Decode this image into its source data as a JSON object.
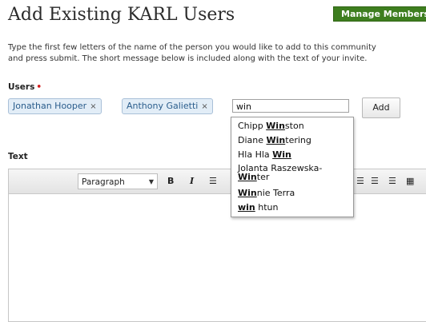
{
  "page": {
    "title": "Add Existing KARL Users",
    "manage_button": "Manage Members"
  },
  "intro": {
    "line1": "Type the first few letters of the name of the person you would like to add to this community",
    "line2": "and press submit. The short message below is included along with the text of your invite."
  },
  "users": {
    "label": "Users",
    "required_marker": "•",
    "selected": [
      {
        "name": "Jonathan Hooper",
        "remove": "×"
      },
      {
        "name": "Anthony Galietti",
        "remove": "×"
      }
    ],
    "search_value": "win",
    "add_button": "Add"
  },
  "autocomplete": [
    {
      "before": "Chipp ",
      "match": "Win",
      "after": "ston"
    },
    {
      "before": "Diane ",
      "match": "Win",
      "after": "tering"
    },
    {
      "before": "Hla Hla ",
      "match": "Win",
      "after": ""
    },
    {
      "before": "Jolanta Raszewska-",
      "match": "Win",
      "after": "ter"
    },
    {
      "before": "",
      "match": "Win",
      "after": "nie Terra"
    },
    {
      "before": "",
      "match": "win",
      "after": " htun"
    }
  ],
  "editor": {
    "label": "Text",
    "format": "Paragraph",
    "bold_icon": "B",
    "italic_icon": "I",
    "list_icon": "☰"
  }
}
